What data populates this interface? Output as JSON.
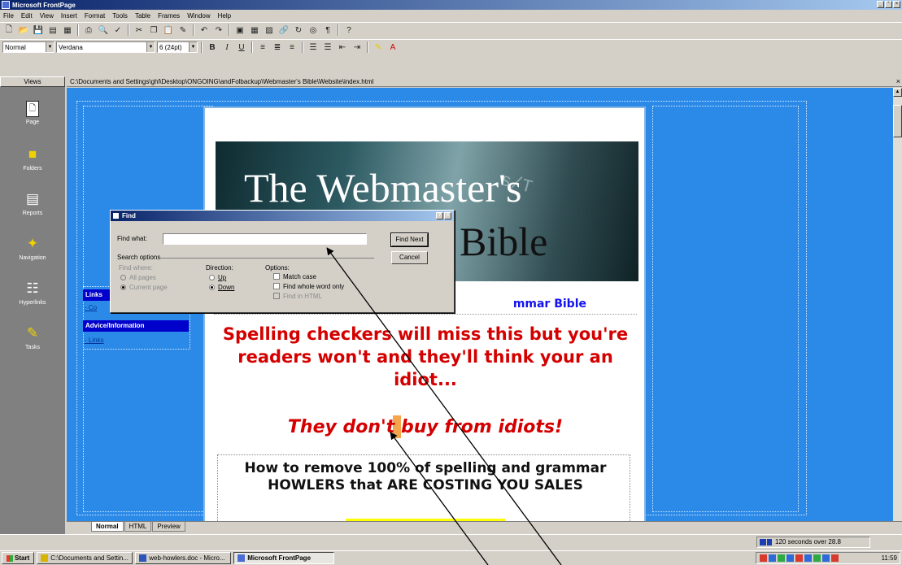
{
  "window": {
    "title": "Microsoft FrontPage",
    "buttons": [
      "_",
      "°",
      "×"
    ]
  },
  "menu": [
    "File",
    "Edit",
    "View",
    "Insert",
    "Format",
    "Tools",
    "Table",
    "Frames",
    "Window",
    "Help"
  ],
  "format_toolbar": {
    "style": "Normal",
    "font": "Verdana",
    "size": "6 (24pt)",
    "bold": "B",
    "italic": "I",
    "underline": "U"
  },
  "views": {
    "header": "Views",
    "items": [
      {
        "label": "Page",
        "icon": "page-icon"
      },
      {
        "label": "Folders",
        "icon": "folders-icon"
      },
      {
        "label": "Reports",
        "icon": "reports-icon"
      },
      {
        "label": "Navigation",
        "icon": "navigation-icon"
      },
      {
        "label": "Hyperlinks",
        "icon": "hyperlinks-icon"
      },
      {
        "label": "Tasks",
        "icon": "tasks-icon"
      }
    ]
  },
  "path": "C:\\Documents and Settings\\ghl\\Desktop\\ONGOING\\andFolbackup\\Webmaster's Bible\\Website\\index.html",
  "page": {
    "banner_line1": "The Webmaster's",
    "banner_line2": "Bible",
    "subhead": "mmar Bible",
    "headline": "Spelling checkers will miss this but you're readers won't and they'll think your an idiot...",
    "tagline": "They don't buy from idiots!",
    "howto": "How to remove 100% of spelling and grammar HOWLERS that ARE COSTING YOU SALES"
  },
  "sidebar_links": {
    "links_head": "Links",
    "link1": "- Co",
    "advice_head": "Advice/Information",
    "link2": "- Links"
  },
  "find_dialog": {
    "title": "Find",
    "help": "?",
    "close": "×",
    "find_what_label": "Find what:",
    "find_what_value": "",
    "find_next": "Find Next",
    "cancel": "Cancel",
    "search_options": "Search options",
    "find_where": "Find where:",
    "all_pages": "All pages",
    "current_page": "Current page",
    "direction": "Direction:",
    "up": "Up",
    "down": "Down",
    "options": "Options:",
    "match_case": "Match case",
    "whole_word": "Find whole word only",
    "find_html": "Find in HTML"
  },
  "view_tabs": [
    "Normal",
    "HTML",
    "Preview"
  ],
  "status": {
    "download": "120 seconds over 28.8"
  },
  "taskbar": {
    "start": "Start",
    "tasks": [
      "C:\\Documents and Settin...",
      "web-howlers.doc - Micro...",
      "Microsoft FrontPage"
    ],
    "clock": "11:59"
  }
}
